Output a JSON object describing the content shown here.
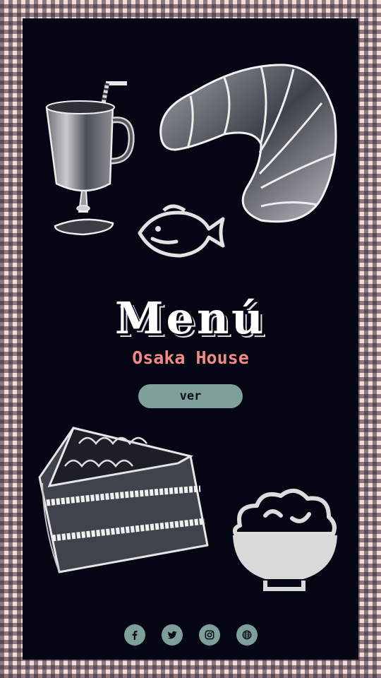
{
  "menu": {
    "title": "Menú",
    "subtitle": "Osaka House",
    "view_button_label": "ver"
  },
  "colors": {
    "board": "#040614",
    "accent": "#7fa09a",
    "subtitle": "#f28a85",
    "check_light": "#f7dcd6",
    "check_dark": "#342838"
  },
  "socials": [
    {
      "name": "facebook",
      "icon": "facebook-icon"
    },
    {
      "name": "twitter",
      "icon": "twitter-icon"
    },
    {
      "name": "instagram",
      "icon": "instagram-icon"
    },
    {
      "name": "website",
      "icon": "globe-icon"
    }
  ]
}
